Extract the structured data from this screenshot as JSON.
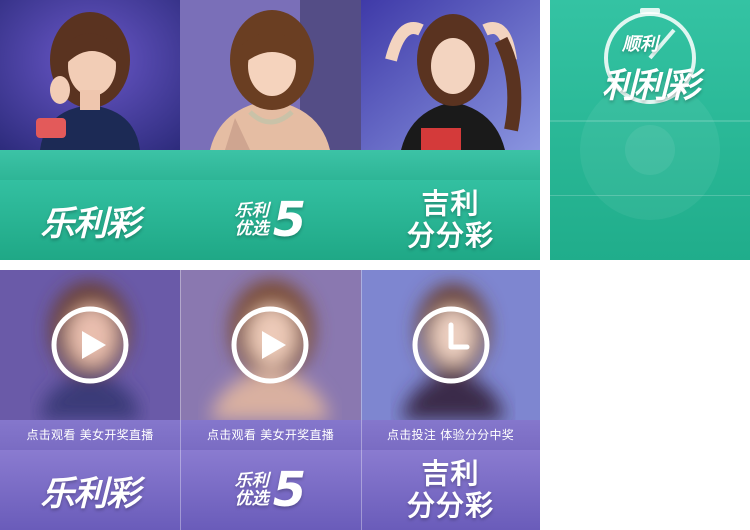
{
  "grid_top": {
    "tiles": [
      {
        "logo_lines": [
          "乐利彩"
        ],
        "style": "single"
      },
      {
        "logo_small": [
          "乐利",
          "优选"
        ],
        "logo_big": "5",
        "style": "rx5"
      },
      {
        "logo_lines": [
          "吉利",
          "分分彩"
        ],
        "style": "jl"
      }
    ]
  },
  "side_panel": {
    "logo_line1": "顺利",
    "logo_line2": "利利彩"
  },
  "grid_bottom": {
    "tiles": [
      {
        "caption": "点击观看 美女开奖直播",
        "icon": "play-icon",
        "logo_lines": [
          "乐利彩"
        ],
        "style": "single"
      },
      {
        "caption": "点击观看 美女开奖直播",
        "icon": "play-icon",
        "logo_small": [
          "乐利",
          "优选"
        ],
        "logo_big": "5",
        "style": "rx5"
      },
      {
        "caption": "点击投注 体验分分中奖",
        "icon": "clock-icon",
        "logo_lines": [
          "吉利",
          "分分彩"
        ],
        "style": "jl"
      }
    ]
  },
  "colors": {
    "green_accent": "#2eb596",
    "purple_accent": "#7a6cc3",
    "white": "#ffffff"
  }
}
